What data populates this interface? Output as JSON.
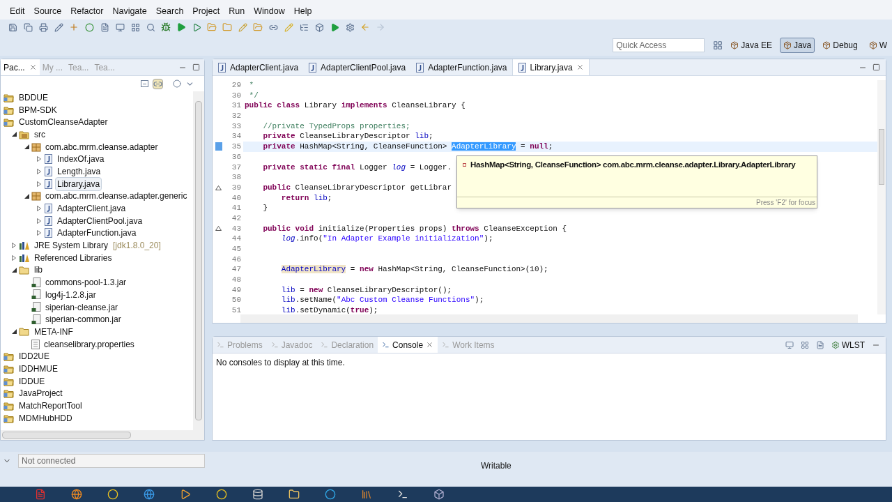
{
  "menu": [
    "Edit",
    "Source",
    "Refactor",
    "Navigate",
    "Search",
    "Project",
    "Run",
    "Window",
    "Help"
  ],
  "quick_access": {
    "placeholder": "Quick Access"
  },
  "perspectives": [
    {
      "label": "Java EE",
      "selected": false
    },
    {
      "label": "Java",
      "selected": true
    },
    {
      "label": "Debug",
      "selected": false
    },
    {
      "label": "W",
      "selected": false
    }
  ],
  "left_tabs": [
    {
      "label": "Pac...",
      "selected": true
    },
    {
      "label": "My ...",
      "selected": false
    },
    {
      "label": "Tea...",
      "selected": false
    },
    {
      "label": "Tea...",
      "selected": false
    }
  ],
  "tree": [
    {
      "label": "BDDUE",
      "kind": "project",
      "selected": false
    },
    {
      "label": "BPM-SDK",
      "kind": "project",
      "selected": false
    },
    {
      "label": "CustomCleanseAdapter",
      "kind": "project",
      "selected": false,
      "children": [
        {
          "label": "src",
          "kind": "source",
          "expanded": true,
          "selected": false,
          "children": [
            {
              "label": "com.abc.mrm.cleanse.adapter",
              "kind": "package",
              "expanded": true,
              "selected": false,
              "children": [
                {
                  "label": "IndexOf.java",
                  "kind": "java",
                  "expanded": false,
                  "selected": false
                },
                {
                  "label": "Length.java",
                  "kind": "java",
                  "expanded": false,
                  "selected": false
                },
                {
                  "label": "Library.java",
                  "kind": "java",
                  "expanded": false,
                  "selected": true
                }
              ]
            },
            {
              "label": "com.abc.mrm.cleanse.adapter.generic",
              "kind": "package",
              "expanded": true,
              "selected": false,
              "children": [
                {
                  "label": "AdapterClient.java",
                  "kind": "java",
                  "expanded": false,
                  "selected": false
                },
                {
                  "label": "AdapterClientPool.java",
                  "kind": "java",
                  "expanded": false,
                  "selected": false
                },
                {
                  "label": "AdapterFunction.java",
                  "kind": "java",
                  "expanded": false,
                  "selected": false
                }
              ]
            }
          ]
        },
        {
          "label": "JRE System Library",
          "suffix": "[jdk1.8.0_20]",
          "kind": "library",
          "expanded": false,
          "selected": false
        },
        {
          "label": "Referenced Libraries",
          "kind": "library",
          "expanded": false,
          "selected": false
        },
        {
          "label": "lib",
          "kind": "folder",
          "expanded": true,
          "selected": false,
          "children": [
            {
              "label": "commons-pool-1.3.jar",
              "kind": "jar",
              "selected": false
            },
            {
              "label": "log4j-1.2.8.jar",
              "kind": "jar",
              "selected": false
            },
            {
              "label": "siperian-cleanse.jar",
              "kind": "jar",
              "selected": false
            },
            {
              "label": "siperian-common.jar",
              "kind": "jar",
              "selected": false
            }
          ]
        },
        {
          "label": "META-INF",
          "kind": "folder",
          "expanded": true,
          "selected": false,
          "children": [
            {
              "label": "cleanselibrary.properties",
              "kind": "text",
              "selected": false
            }
          ]
        }
      ]
    },
    {
      "label": "IDD2UE",
      "kind": "project",
      "selected": false
    },
    {
      "label": "IDDHMUE",
      "kind": "project",
      "selected": false
    },
    {
      "label": "IDDUE",
      "kind": "project",
      "selected": false
    },
    {
      "label": "JavaProject",
      "kind": "project",
      "selected": false
    },
    {
      "label": "MatchReportTool",
      "kind": "project",
      "selected": false
    },
    {
      "label": "MDMHubHDD",
      "kind": "project",
      "selected": false
    }
  ],
  "editor_tabs": [
    {
      "label": "AdapterClient.java",
      "selected": false
    },
    {
      "label": "AdapterClientPool.java",
      "selected": false
    },
    {
      "label": "AdapterFunction.java",
      "selected": false
    },
    {
      "label": "Library.java",
      "selected": true
    }
  ],
  "code": [
    {
      "number": "29",
      "current": false,
      "override": false,
      "segments": [
        {
          "text": " *",
          "kind": "comment"
        }
      ]
    },
    {
      "number": "30",
      "current": false,
      "override": false,
      "segments": [
        {
          "text": " */",
          "kind": "comment"
        }
      ]
    },
    {
      "number": "31",
      "current": false,
      "override": false,
      "segments": [
        {
          "text": "public class",
          "kind": "keyword"
        },
        {
          "text": " Library ",
          "kind": "plain"
        },
        {
          "text": "implements",
          "kind": "keyword"
        },
        {
          "text": " CleanseLibrary {",
          "kind": "plain"
        }
      ]
    },
    {
      "number": "32",
      "current": false,
      "override": false
    },
    {
      "number": "33",
      "current": false,
      "override": false,
      "segments": [
        {
          "text": "    //private TypedProps properties;",
          "kind": "comment"
        }
      ]
    },
    {
      "number": "34",
      "current": false,
      "override": false,
      "segments": [
        {
          "text": "    private",
          "kind": "keyword"
        },
        {
          "text": " CleanseLibraryDescriptor ",
          "kind": "plain"
        },
        {
          "text": "lib",
          "kind": "field"
        },
        {
          "text": ";",
          "kind": "plain"
        }
      ]
    },
    {
      "number": "35",
      "current": true,
      "override": false,
      "segments": [
        {
          "text": "    private",
          "kind": "keyword"
        },
        {
          "text": " HashMap<String, CleanseFunction> ",
          "kind": "plain"
        },
        {
          "text": "AdapterLibrary",
          "kind": "selection"
        },
        {
          "text": " = ",
          "kind": "plain"
        },
        {
          "text": "null",
          "kind": "keyword"
        },
        {
          "text": ";",
          "kind": "plain"
        }
      ]
    },
    {
      "number": "36",
      "current": false,
      "override": false
    },
    {
      "number": "37",
      "current": false,
      "override": false,
      "segments": [
        {
          "text": "    private static final",
          "kind": "keyword"
        },
        {
          "text": " Logger ",
          "kind": "plain"
        },
        {
          "text": "log",
          "kind": "static"
        },
        {
          "text": " = Logger.",
          "kind": "plain"
        }
      ]
    },
    {
      "number": "38",
      "current": false,
      "override": false
    },
    {
      "number": "39",
      "current": false,
      "override": true,
      "segments": [
        {
          "text": "    public",
          "kind": "keyword"
        },
        {
          "text": " CleanseLibraryDescriptor getLibrar",
          "kind": "plain"
        }
      ]
    },
    {
      "number": "40",
      "current": false,
      "override": false,
      "segments": [
        {
          "text": "        return ",
          "kind": "keyword"
        },
        {
          "text": "lib",
          "kind": "field"
        },
        {
          "text": ";",
          "kind": "plain"
        }
      ]
    },
    {
      "number": "41",
      "current": false,
      "override": false,
      "segments": [
        {
          "text": "    }",
          "kind": "plain"
        }
      ]
    },
    {
      "number": "42",
      "current": false,
      "override": false
    },
    {
      "number": "43",
      "current": false,
      "override": true,
      "segments": [
        {
          "text": "    public void",
          "kind": "keyword"
        },
        {
          "text": " initialize(Properties props) ",
          "kind": "plain"
        },
        {
          "text": "throws",
          "kind": "keyword"
        },
        {
          "text": " CleanseException {",
          "kind": "plain"
        }
      ]
    },
    {
      "number": "44",
      "current": false,
      "override": false,
      "segments": [
        {
          "text": "        log",
          "kind": "static"
        },
        {
          "text": ".info(",
          "kind": "plain"
        },
        {
          "text": "\"In Adapter Example initialization\"",
          "kind": "string"
        },
        {
          "text": ");",
          "kind": "plain"
        }
      ]
    },
    {
      "number": "45",
      "current": false,
      "override": false
    },
    {
      "number": "46",
      "current": false,
      "override": false
    },
    {
      "number": "47",
      "current": false,
      "override": false,
      "segments": [
        {
          "text": "AdapterLibrary",
          "kind": "occurrence",
          "indent": true
        },
        {
          "text": " = ",
          "kind": "plain"
        },
        {
          "text": "new",
          "kind": "keyword"
        },
        {
          "text": " HashMap<String, CleanseFunction>(10);",
          "kind": "plain"
        }
      ]
    },
    {
      "number": "48",
      "current": false,
      "override": false
    },
    {
      "number": "49",
      "current": false,
      "override": false,
      "segments": [
        {
          "text": "        lib",
          "kind": "field"
        },
        {
          "text": " = ",
          "kind": "plain"
        },
        {
          "text": "new",
          "kind": "keyword"
        },
        {
          "text": " CleanseLibraryDescriptor();",
          "kind": "plain"
        }
      ]
    },
    {
      "number": "50",
      "current": false,
      "override": false,
      "segments": [
        {
          "text": "        lib",
          "kind": "field"
        },
        {
          "text": ".setName(",
          "kind": "plain"
        },
        {
          "text": "\"Abc Custom Cleanse Functions\"",
          "kind": "string"
        },
        {
          "text": ");",
          "kind": "plain"
        }
      ]
    },
    {
      "number": "51",
      "current": false,
      "override": false,
      "segments": [
        {
          "text": "        lib",
          "kind": "field"
        },
        {
          "text": ".setDynamic(",
          "kind": "plain"
        },
        {
          "text": "true",
          "kind": "keyword"
        },
        {
          "text": ");",
          "kind": "plain"
        }
      ]
    }
  ],
  "hover": {
    "signature": "HashMap<String, CleanseFunction> com.abc.mrm.cleanse.adapter.Library.AdapterLibrary",
    "footer": "Press 'F2' for focus"
  },
  "bottom_tabs": [
    {
      "label": "Problems",
      "selected": false
    },
    {
      "label": "Javadoc",
      "selected": false
    },
    {
      "label": "Declaration",
      "selected": false
    },
    {
      "label": "Console",
      "selected": true
    },
    {
      "label": "Work Items",
      "selected": false
    }
  ],
  "wlst": "WLST",
  "console_message": "No consoles to display at this time.",
  "status": {
    "connection": "Not connected",
    "mode": "Writable"
  }
}
